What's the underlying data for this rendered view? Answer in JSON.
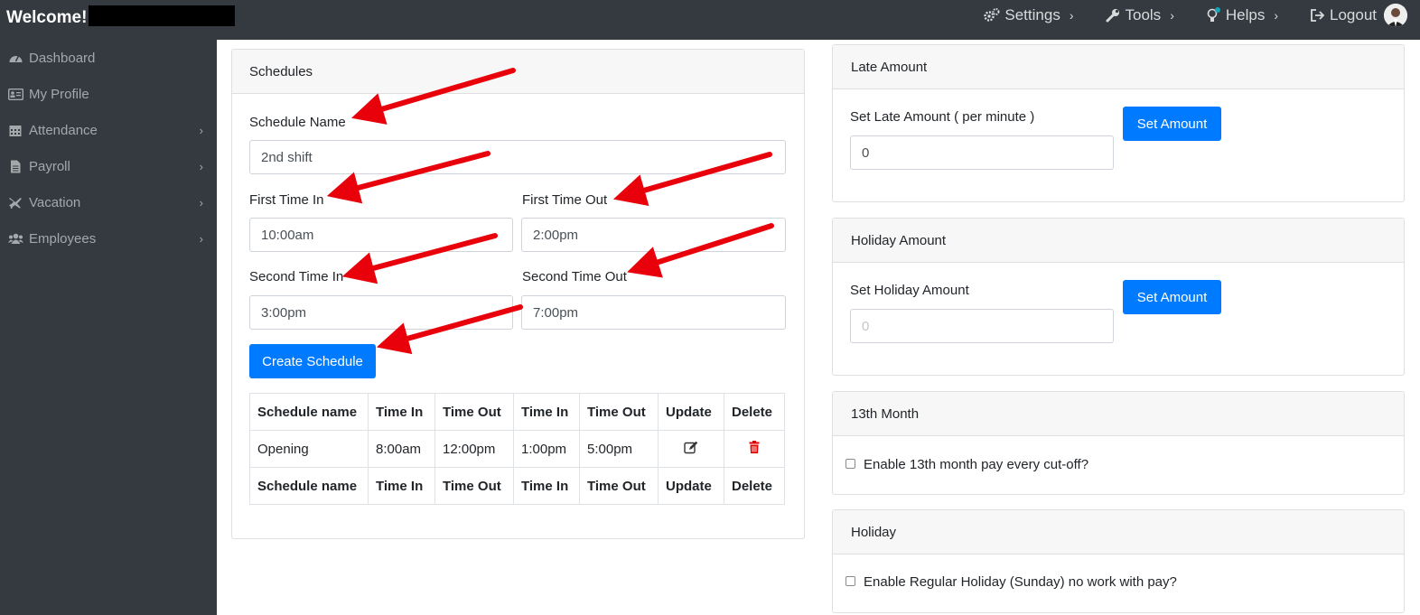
{
  "header": {
    "welcome": "Welcome!",
    "nav": [
      {
        "label": "Settings",
        "icon": "gears-icon"
      },
      {
        "label": "Tools",
        "icon": "wrench-icon"
      },
      {
        "label": "Helps",
        "icon": "lightbulb-icon"
      },
      {
        "label": "Logout",
        "icon": "logout-icon"
      }
    ]
  },
  "sidebar": {
    "items": [
      {
        "label": "Dashboard",
        "icon": "dashboard-icon",
        "has_submenu": false
      },
      {
        "label": "My Profile",
        "icon": "id-card-icon",
        "has_submenu": false
      },
      {
        "label": "Attendance",
        "icon": "calendar-icon",
        "has_submenu": true
      },
      {
        "label": "Payroll",
        "icon": "document-icon",
        "has_submenu": true
      },
      {
        "label": "Vacation",
        "icon": "plane-icon",
        "has_submenu": true
      },
      {
        "label": "Employees",
        "icon": "users-icon",
        "has_submenu": true
      }
    ]
  },
  "schedules": {
    "title": "Schedules",
    "name_label": "Schedule Name",
    "name_value": "2nd shift",
    "first_in_label": "First Time In",
    "first_in_value": "10:00am",
    "first_out_label": "First Time Out",
    "first_out_value": "2:00pm",
    "second_in_label": "Second Time In",
    "second_in_value": "3:00pm",
    "second_out_label": "Second Time Out",
    "second_out_value": "7:00pm",
    "create_button": "Create Schedule",
    "table": {
      "columns": [
        "Schedule name",
        "Time In",
        "Time Out",
        "Time In",
        "Time Out",
        "Update",
        "Delete"
      ],
      "rows": [
        {
          "name": "Opening",
          "in1": "8:00am",
          "out1": "12:00pm",
          "in2": "1:00pm",
          "out2": "5:00pm"
        }
      ]
    }
  },
  "late_amount": {
    "title": "Late Amount",
    "label": "Set Late Amount ( per minute )",
    "value": "0",
    "button": "Set Amount"
  },
  "holiday_amount": {
    "title": "Holiday Amount",
    "label": "Set Holiday Amount",
    "placeholder": "0",
    "button": "Set Amount"
  },
  "thirteenth_month": {
    "title": "13th Month",
    "checkbox_label": "Enable 13th month pay every cut-off?",
    "checked": false
  },
  "holiday": {
    "title": "Holiday",
    "checkbox_label": "Enable Regular Holiday (Sunday) no work with pay?",
    "checked": false
  },
  "colors": {
    "primary": "#007bff",
    "sidebar_bg": "#343a40",
    "annotation_arrow": "#e8000b",
    "delete_icon": "#e00000"
  }
}
